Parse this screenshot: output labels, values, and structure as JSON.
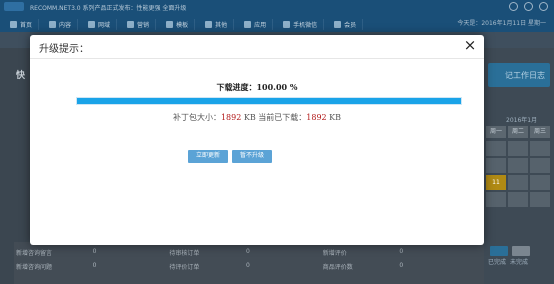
{
  "background": {
    "topbar_text": "RECOMM.NET3.0 系列产品正式发布：性能更强 全面升级",
    "date": "今天是：2016年1月11日 星期一",
    "menu": [
      {
        "label": "首页",
        "icon": "home-icon"
      },
      {
        "label": "内容",
        "icon": "document-icon"
      },
      {
        "label": "网域",
        "icon": "globe-icon"
      },
      {
        "label": "营销",
        "icon": "chart-icon"
      },
      {
        "label": "模板",
        "icon": "template-icon"
      },
      {
        "label": "其他",
        "icon": "tag-icon"
      },
      {
        "label": "应用",
        "icon": "monitor-icon"
      },
      {
        "label": "手机微信",
        "icon": "mobile-icon"
      },
      {
        "label": "会员",
        "icon": "user-icon"
      }
    ],
    "left_heading": "快",
    "right_header": "记工作日志",
    "calendar": {
      "month": "2016年1月",
      "weekdays": [
        "周一",
        "周二",
        "周三"
      ],
      "today": "11"
    },
    "right_buttons": [
      "已完成",
      "未完成"
    ],
    "table_rows": [
      [
        "新增咨询留言",
        "0",
        "待审核订单",
        "0",
        "新增评价",
        "0"
      ],
      [
        "新增咨询问题",
        "0",
        "待评价订单",
        "0",
        "商品评价数",
        "0"
      ]
    ]
  },
  "modal": {
    "title": "升级提示：",
    "progress_label": "下载进度：100.00 %",
    "progress": 1.0,
    "size_prefix": "补丁包大小：",
    "patch_size": "1892",
    "unit1": "KB",
    "downloaded_prefix": "当前已下载：",
    "downloaded": "1892",
    "unit2": "KB",
    "update_now": "立即更新",
    "later": "暂不升级",
    "close": "×"
  },
  "colors": {
    "progress_fill": "#1aa3e8",
    "button": "#5ba3d6",
    "number": "#b31b1b"
  }
}
